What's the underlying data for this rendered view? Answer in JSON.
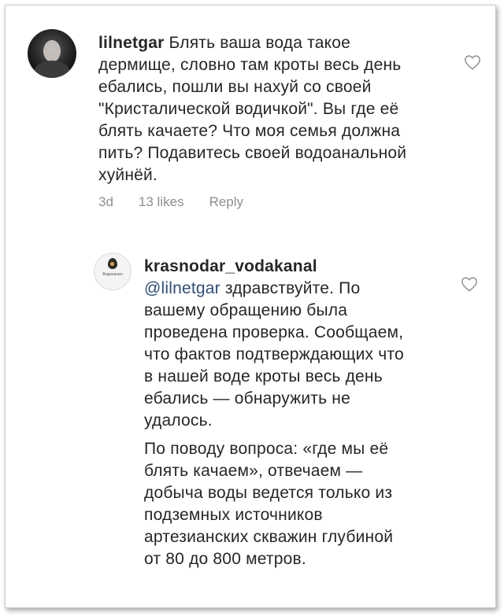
{
  "comment1": {
    "username": "lilnetgar",
    "text": "Блять ваша вода такое дермище, словно там кроты весь день ебались, пошли вы нахуй со своей \"Кристалической водичкой\". Вы где её блять качаете? Что моя семья должна пить? Подавитесь своей водоанальной хуйнёй.",
    "time": "3d",
    "likes": "13 likes",
    "reply": "Reply",
    "avatar_icon": "user-photo",
    "like_icon": "heart-outline-icon"
  },
  "comment2": {
    "username": "krasnodar_vodakanal",
    "mention": "@lilnetgar",
    "paragraph1": "здравствуйте. По вашему обращению была проведена проверка. Сообщаем, что фактов подтверждающих что в нашей воде кроты весь день ебались — обнаружить не удалось.",
    "paragraph2": "По поводу вопроса: «где мы её блять качаем», отвечаем — добыча воды ведется только из подземных источников артезианских скважин глубиной от 80 до 800 метров.",
    "avatar_logo_text": "Водоканал",
    "avatar_icon": "water-drop-logo",
    "like_icon": "heart-outline-icon"
  },
  "colors": {
    "text": "#262626",
    "meta": "#8e8e8e",
    "mention": "#2d4e7a"
  }
}
